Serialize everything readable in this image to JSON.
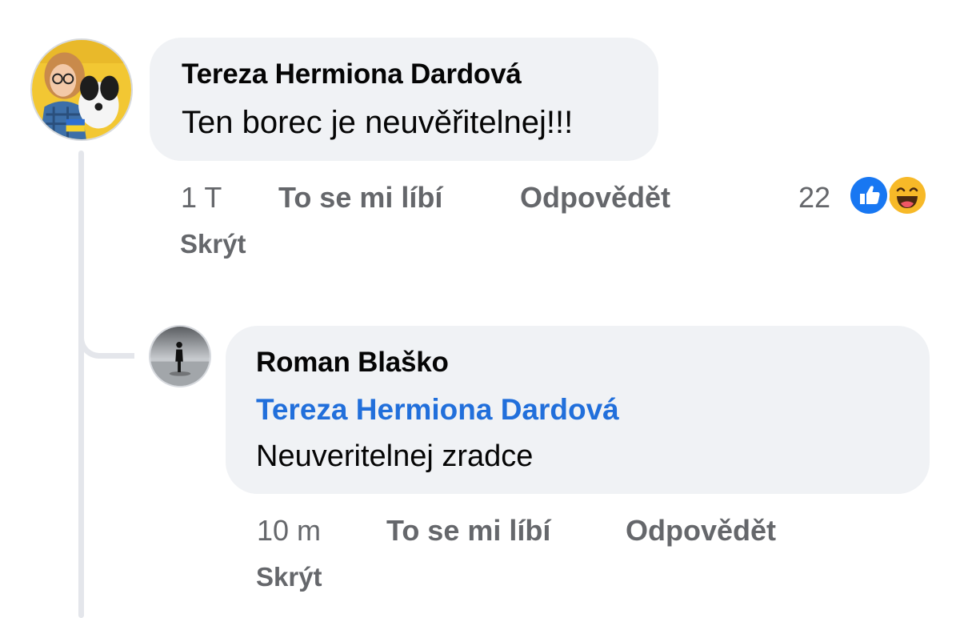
{
  "comment": {
    "author": "Tereza Hermiona Dardová",
    "text": "Ten borec je neuvěřitelnej!!!",
    "time": "1 T",
    "like_label": "To se mi líbí",
    "reply_label": "Odpovědět",
    "hide_label": "Skrýt",
    "reaction_count": "22",
    "reactions": [
      "like-icon",
      "haha-icon"
    ]
  },
  "reply": {
    "author": "Roman Blaško",
    "mention": "Tereza Hermiona Dardová",
    "text": "Neuveritelnej zradce",
    "time": "10 m",
    "like_label": "To se mi líbí",
    "reply_label": "Odpovědět",
    "hide_label": "Skrýt"
  },
  "colors": {
    "bubble": "#f0f2f5",
    "meta_text": "#65676b",
    "mention": "#216fdb",
    "like_blue": "#1877f2",
    "haha_yellow": "#f7b928"
  }
}
